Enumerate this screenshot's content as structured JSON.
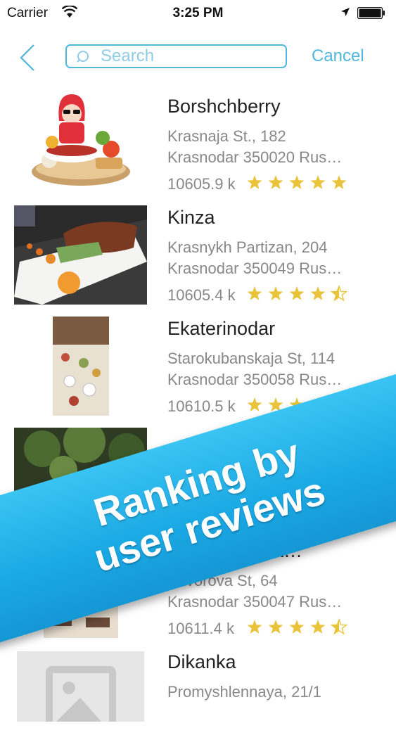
{
  "status": {
    "carrier": "Carrier",
    "time": "3:25 PM"
  },
  "search": {
    "placeholder": "Search",
    "cancel_label": "Cancel"
  },
  "restaurants": [
    {
      "name": "Borshchberry",
      "address1": "Krasnaja St., 182",
      "address2": "Krasnodar 350020 Rus…",
      "distance": "10605.9 k",
      "rating": 5
    },
    {
      "name": "Kinza",
      "address1": "Krasnykh Partizan, 204",
      "address2": "Krasnodar 350049 Rus…",
      "distance": "10605.4 k",
      "rating": 4.5
    },
    {
      "name": "Ekaterinodar",
      "address1": "Starokubanskaja St, 114",
      "address2": "Krasnodar 350058 Rus…",
      "distance": "10610.5 k",
      "rating": 4
    },
    {
      "name": "",
      "address1": "",
      "address2": "",
      "distance": "",
      "rating": 0
    },
    {
      "name": "…Meat Resta…",
      "address1": "Suvorova St, 64",
      "address2": "Krasnodar 350047 Rus…",
      "distance": "10611.4 k",
      "rating": 4.5
    },
    {
      "name": "Dikanka",
      "address1": "Promyshlennaya, 21/1",
      "address2": "",
      "distance": "",
      "rating": 0
    }
  ],
  "banner": {
    "line1": "Ranking by",
    "line2": "user reviews"
  },
  "colors": {
    "accent": "#4fb6dc",
    "star": "#e9c43b",
    "banner": "#1aa8e4"
  }
}
